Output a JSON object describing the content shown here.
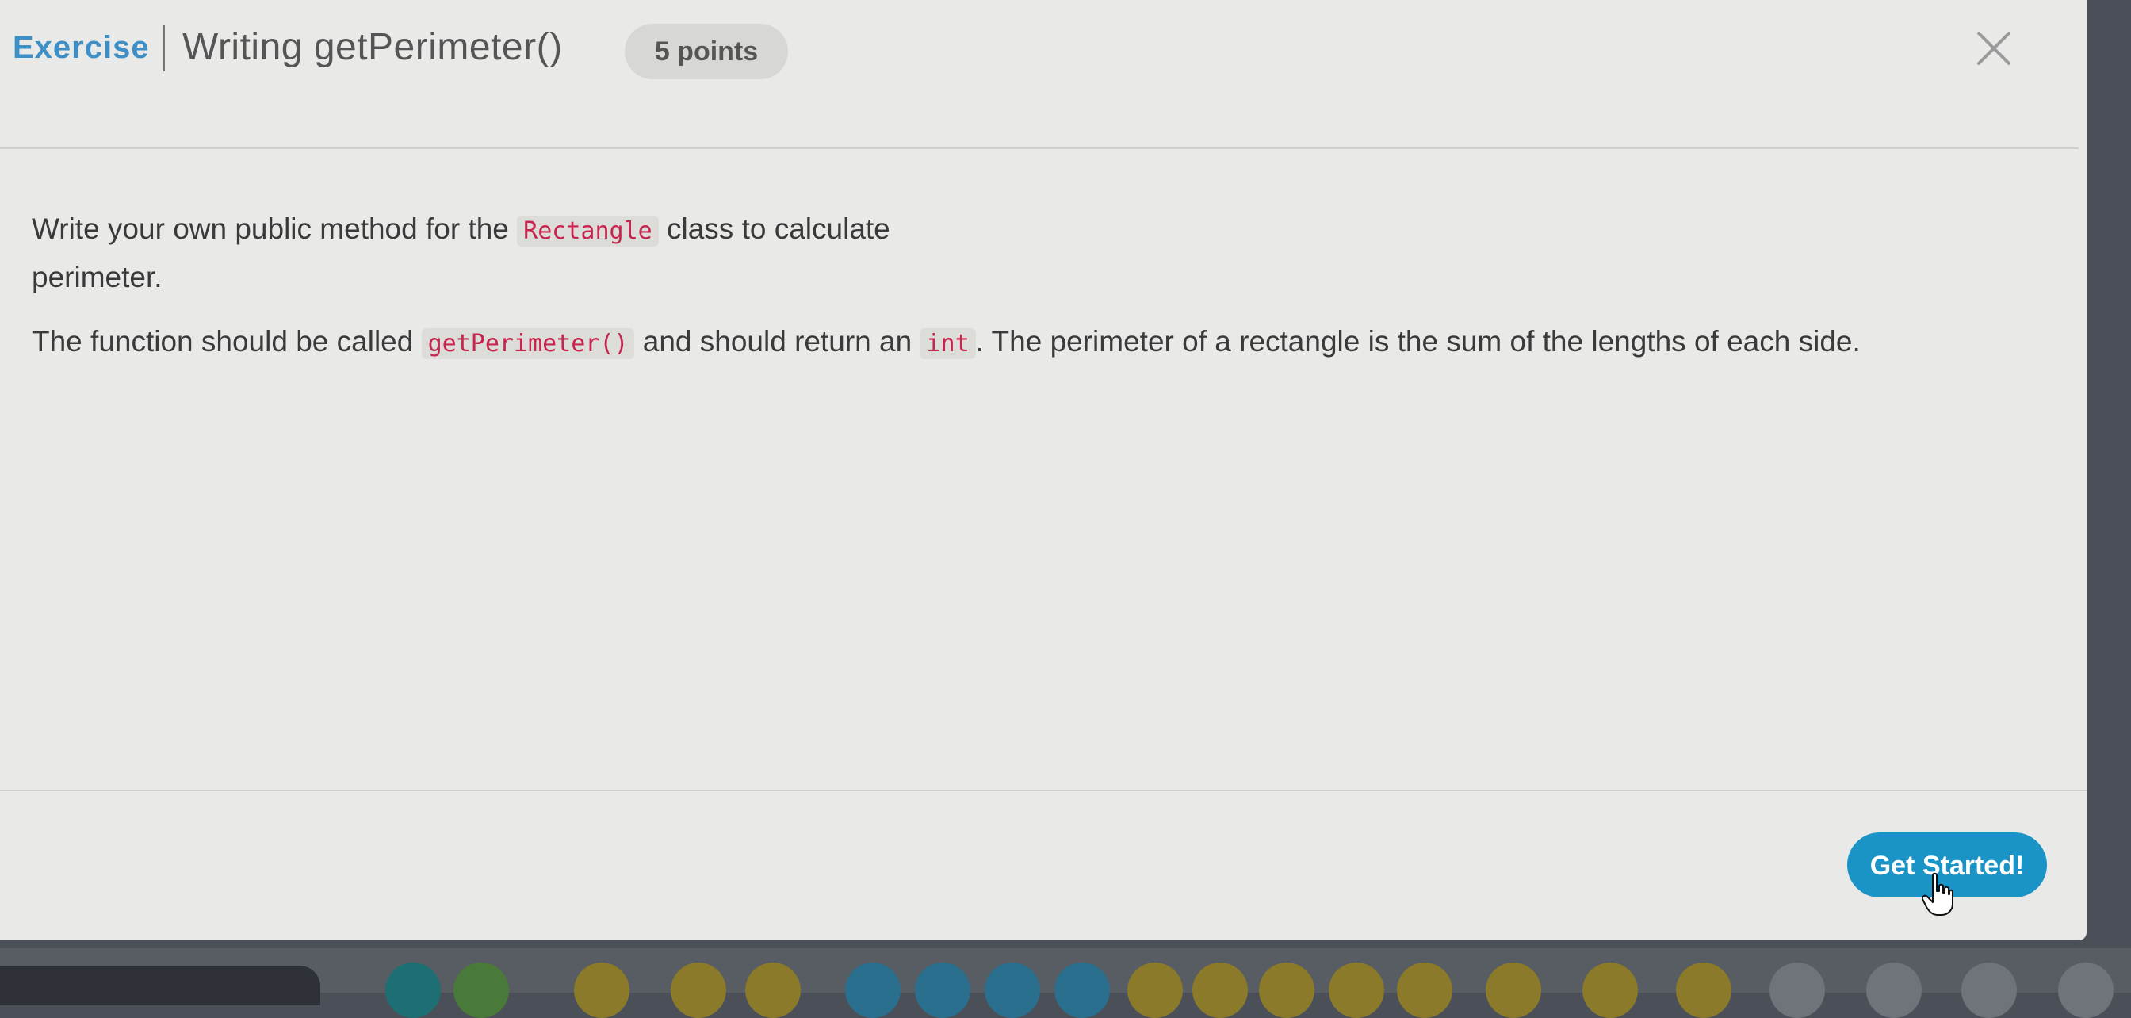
{
  "header": {
    "kind_label": "Exercise",
    "title": "Writing getPerimeter()",
    "points_label": "5 points"
  },
  "body": {
    "paragraph1": {
      "before": "Write your own public method for the ",
      "code": "Rectangle",
      "after": " class to calculate perimeter."
    },
    "paragraph2": {
      "part1": "The function should be called ",
      "code1": "getPerimeter()",
      "part2": " and should return an ",
      "code2": "int",
      "part3": ". The perimeter of a rectangle is the sum of the lengths of each side."
    }
  },
  "footer": {
    "get_started_label": "Get Started!"
  },
  "colors": {
    "accent": "#3d8fc6",
    "button": "#1a94c6",
    "code_text": "#c7254e",
    "dot_teal": "#1e6f74",
    "dot_green": "#4a7a3a",
    "dot_olive": "#8a7a2a",
    "dot_blue": "#2a6f8e",
    "dot_gray": "#6f737a"
  },
  "icons": {
    "close": "close-icon",
    "cursor": "hand-cursor-icon"
  }
}
